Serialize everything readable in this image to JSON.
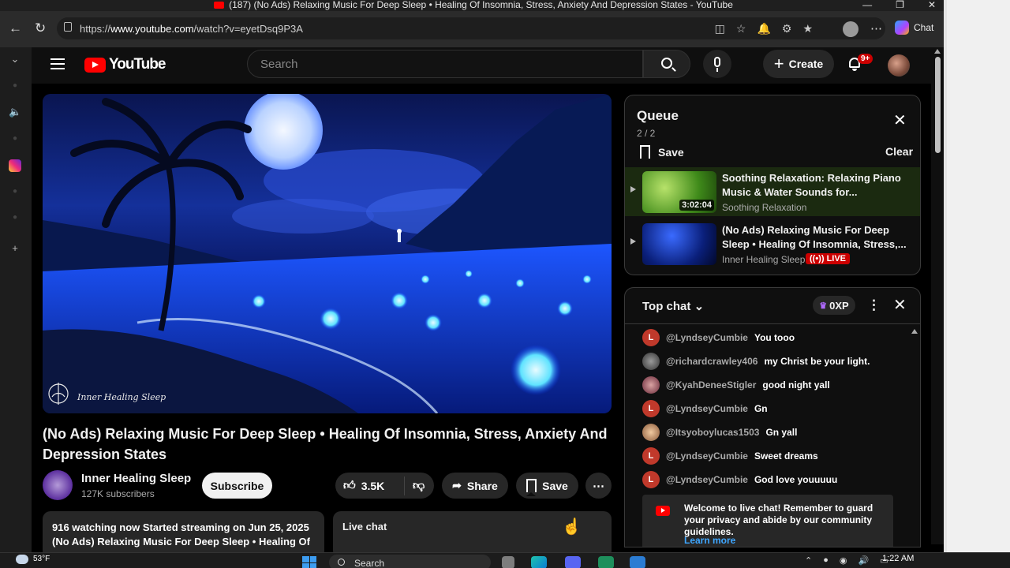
{
  "browser": {
    "tab_title": "(187) (No Ads) Relaxing Music For Deep Sleep • Healing Of Insomnia, Stress, Anxiety And Depression States - YouTube",
    "url_prefix": "https://",
    "url_domain": "www.youtube.com",
    "url_path": "/watch?v=eyetDsq9P3A",
    "chat_label": "Chat"
  },
  "youtube": {
    "logo_text": "YouTube",
    "search_placeholder": "Search",
    "create_label": "Create",
    "notif_badge": "9+"
  },
  "video": {
    "watermark": "Inner Healing Sleep",
    "title": "(No Ads) Relaxing Music For Deep Sleep • Healing Of Insomnia, Stress, Anxiety And Depression States",
    "channel_name": "Inner Healing Sleep",
    "subscribers": "127K subscribers",
    "subscribe_label": "Subscribe",
    "likes": "3.5K",
    "share_label": "Share",
    "save_label": "Save",
    "description_line1": "916 watching now  Started streaming on Jun 25, 2025",
    "description_line2": "(No Ads) Relaxing Music For Deep Sleep • Healing Of",
    "live_chat_label": "Live chat"
  },
  "queue": {
    "title": "Queue",
    "count": "2 / 2",
    "save_label": "Save",
    "clear_label": "Clear",
    "items": [
      {
        "title": "Soothing Relaxation: Relaxing Piano Music & Water Sounds for...",
        "channel": "Soothing Relaxation",
        "duration": "3:02:04"
      },
      {
        "title": "(No Ads) Relaxing Music For Deep Sleep • Healing Of Insomnia, Stress,...",
        "channel": "Inner Healing Sleep",
        "live": "LIVE"
      }
    ]
  },
  "chat": {
    "header": "Top chat",
    "xp": "0XP",
    "messages": [
      {
        "author": "@LyndseyCumbie",
        "text": "You tooo",
        "initial": "L"
      },
      {
        "author": "@richardcrawley406",
        "text": "my Christ be your light."
      },
      {
        "author": "@KyahDeneeStigler",
        "text": "good night yall"
      },
      {
        "author": "@LyndseyCumbie",
        "text": "Gn",
        "initial": "L"
      },
      {
        "author": "@Itsyoboylucas1503",
        "text": "Gn yall"
      },
      {
        "author": "@LyndseyCumbie",
        "text": "Sweet dreams",
        "initial": "L"
      },
      {
        "author": "@LyndseyCumbie",
        "text": "God love youuuuu",
        "initial": "L"
      }
    ],
    "welcome_text": "Welcome to live chat! Remember to guard your privacy and abide by our community guidelines.",
    "learn_more": "Learn more"
  },
  "taskbar": {
    "temperature": "53°F",
    "search_label": "Search",
    "time": "1:22 AM"
  }
}
